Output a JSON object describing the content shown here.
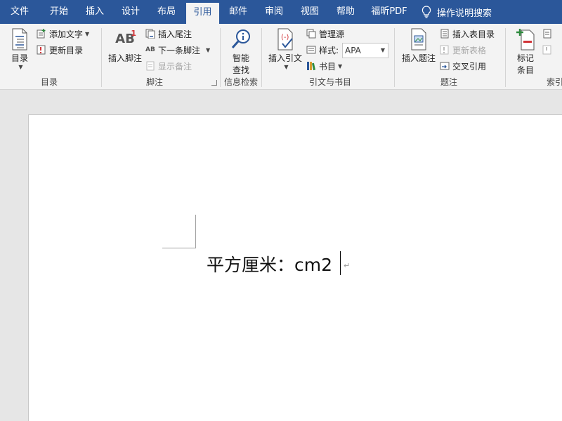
{
  "menu": {
    "tabs": [
      "文件",
      "开始",
      "插入",
      "设计",
      "布局",
      "引用",
      "邮件",
      "审阅",
      "视图",
      "帮助",
      "福昕PDF"
    ],
    "active_tab": "引用",
    "tell_me": "操作说明搜索"
  },
  "ribbon": {
    "toc": {
      "group_label": "目录",
      "toc_button": "目录",
      "add_text": "添加文字",
      "update_toc": "更新目录"
    },
    "footnotes": {
      "group_label": "脚注",
      "insert_footnote": "插入脚注",
      "insert_endnote": "插入尾注",
      "next_footnote": "下一条脚注",
      "show_notes": "显示备注",
      "footnote_icon_text": "AB",
      "footnote_icon_sup": "1",
      "next_icon_text": "AB"
    },
    "research": {
      "group_label": "信息检索",
      "smart_lookup_line1": "智能",
      "smart_lookup_line2": "查找"
    },
    "citations": {
      "group_label": "引文与书目",
      "insert_citation": "插入引文",
      "manage_sources": "管理源",
      "style_label": "样式:",
      "style_value": "APA",
      "bibliography": "书目"
    },
    "captions": {
      "group_label": "题注",
      "insert_caption": "插入题注",
      "insert_table_of_figures": "插入表目录",
      "update_table": "更新表格",
      "cross_reference": "交叉引用"
    },
    "index": {
      "group_label": "索引",
      "mark_entry_line1": "标记",
      "mark_entry_line2": "条目"
    }
  },
  "document": {
    "text": "平方厘米：cm2",
    "paragraph_mark": "↵"
  },
  "colors": {
    "title_bar": "#2b579a",
    "ribbon_bg": "#f3f3f3",
    "canvas_bg": "#e6e6e6"
  }
}
